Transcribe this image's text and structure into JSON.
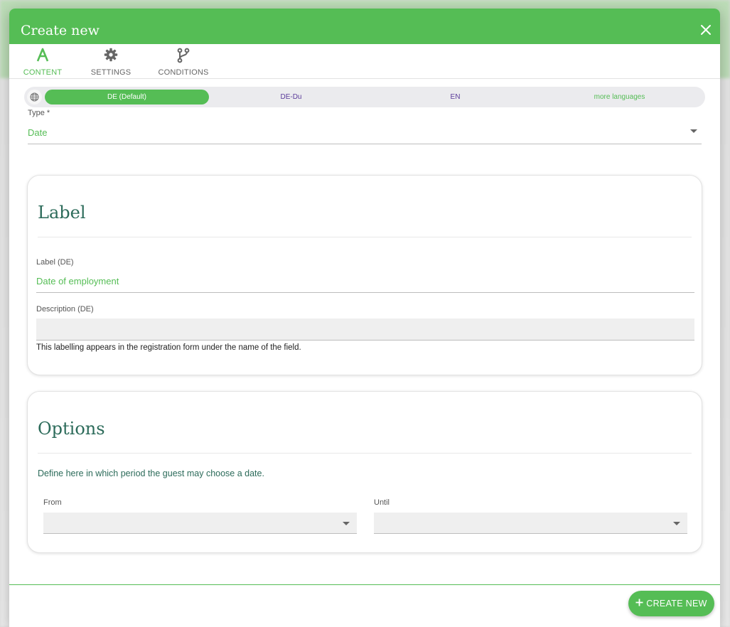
{
  "modal": {
    "title": "Create new",
    "close_icon": "close-icon"
  },
  "tabs": [
    {
      "label": "CONTENT",
      "icon": "font-a-icon",
      "active": true
    },
    {
      "label": "SETTINGS",
      "icon": "gear-icon",
      "active": false
    },
    {
      "label": "CONDITIONS",
      "icon": "branch-icon",
      "active": false
    }
  ],
  "languages": {
    "icon": "globe-icon",
    "items": [
      "DE (Default)",
      "DE-Du",
      "EN",
      "more languages"
    ],
    "active_index": 0
  },
  "type_field": {
    "label": "Type *",
    "value": "Date"
  },
  "label_card": {
    "title": "Label",
    "label_field": {
      "label": "Label (DE)",
      "value": "Date of employment"
    },
    "description_field": {
      "label": "Description (DE)",
      "value": ""
    },
    "helper": "This labelling appears in the registration form under the name of the field."
  },
  "options_card": {
    "title": "Options",
    "description": "Define here in which period the guest may choose a date.",
    "from": {
      "label": "From",
      "value": ""
    },
    "until": {
      "label": "Until",
      "value": ""
    }
  },
  "footer": {
    "create_label": "CREATE NEW",
    "create_icon": "plus-icon"
  },
  "colors": {
    "accent": "#55bd55",
    "heading": "#2c6b5a",
    "language_text": "#5a3a9a"
  }
}
